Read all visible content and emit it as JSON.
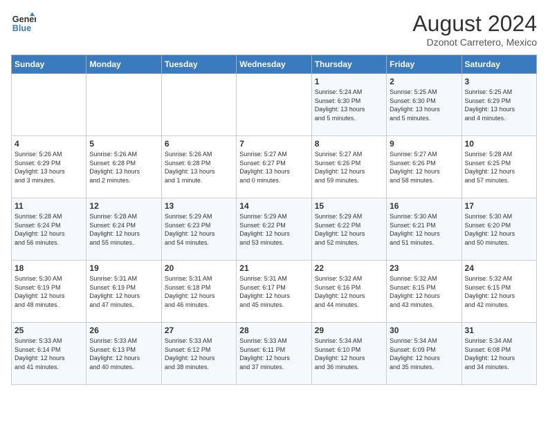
{
  "header": {
    "logo_line1": "General",
    "logo_line2": "Blue",
    "month_year": "August 2024",
    "location": "Dzonot Carretero, Mexico"
  },
  "days_of_week": [
    "Sunday",
    "Monday",
    "Tuesday",
    "Wednesday",
    "Thursday",
    "Friday",
    "Saturday"
  ],
  "weeks": [
    [
      {
        "day": "",
        "info": ""
      },
      {
        "day": "",
        "info": ""
      },
      {
        "day": "",
        "info": ""
      },
      {
        "day": "",
        "info": ""
      },
      {
        "day": "1",
        "info": "Sunrise: 5:24 AM\nSunset: 6:30 PM\nDaylight: 13 hours\nand 5 minutes."
      },
      {
        "day": "2",
        "info": "Sunrise: 5:25 AM\nSunset: 6:30 PM\nDaylight: 13 hours\nand 5 minutes."
      },
      {
        "day": "3",
        "info": "Sunrise: 5:25 AM\nSunset: 6:29 PM\nDaylight: 13 hours\nand 4 minutes."
      }
    ],
    [
      {
        "day": "4",
        "info": "Sunrise: 5:26 AM\nSunset: 6:29 PM\nDaylight: 13 hours\nand 3 minutes."
      },
      {
        "day": "5",
        "info": "Sunrise: 5:26 AM\nSunset: 6:28 PM\nDaylight: 13 hours\nand 2 minutes."
      },
      {
        "day": "6",
        "info": "Sunrise: 5:26 AM\nSunset: 6:28 PM\nDaylight: 13 hours\nand 1 minute."
      },
      {
        "day": "7",
        "info": "Sunrise: 5:27 AM\nSunset: 6:27 PM\nDaylight: 13 hours\nand 0 minutes."
      },
      {
        "day": "8",
        "info": "Sunrise: 5:27 AM\nSunset: 6:26 PM\nDaylight: 12 hours\nand 59 minutes."
      },
      {
        "day": "9",
        "info": "Sunrise: 5:27 AM\nSunset: 6:26 PM\nDaylight: 12 hours\nand 58 minutes."
      },
      {
        "day": "10",
        "info": "Sunrise: 5:28 AM\nSunset: 6:25 PM\nDaylight: 12 hours\nand 57 minutes."
      }
    ],
    [
      {
        "day": "11",
        "info": "Sunrise: 5:28 AM\nSunset: 6:24 PM\nDaylight: 12 hours\nand 56 minutes."
      },
      {
        "day": "12",
        "info": "Sunrise: 5:28 AM\nSunset: 6:24 PM\nDaylight: 12 hours\nand 55 minutes."
      },
      {
        "day": "13",
        "info": "Sunrise: 5:29 AM\nSunset: 6:23 PM\nDaylight: 12 hours\nand 54 minutes."
      },
      {
        "day": "14",
        "info": "Sunrise: 5:29 AM\nSunset: 6:22 PM\nDaylight: 12 hours\nand 53 minutes."
      },
      {
        "day": "15",
        "info": "Sunrise: 5:29 AM\nSunset: 6:22 PM\nDaylight: 12 hours\nand 52 minutes."
      },
      {
        "day": "16",
        "info": "Sunrise: 5:30 AM\nSunset: 6:21 PM\nDaylight: 12 hours\nand 51 minutes."
      },
      {
        "day": "17",
        "info": "Sunrise: 5:30 AM\nSunset: 6:20 PM\nDaylight: 12 hours\nand 50 minutes."
      }
    ],
    [
      {
        "day": "18",
        "info": "Sunrise: 5:30 AM\nSunset: 6:19 PM\nDaylight: 12 hours\nand 48 minutes."
      },
      {
        "day": "19",
        "info": "Sunrise: 5:31 AM\nSunset: 6:19 PM\nDaylight: 12 hours\nand 47 minutes."
      },
      {
        "day": "20",
        "info": "Sunrise: 5:31 AM\nSunset: 6:18 PM\nDaylight: 12 hours\nand 46 minutes."
      },
      {
        "day": "21",
        "info": "Sunrise: 5:31 AM\nSunset: 6:17 PM\nDaylight: 12 hours\nand 45 minutes."
      },
      {
        "day": "22",
        "info": "Sunrise: 5:32 AM\nSunset: 6:16 PM\nDaylight: 12 hours\nand 44 minutes."
      },
      {
        "day": "23",
        "info": "Sunrise: 5:32 AM\nSunset: 6:15 PM\nDaylight: 12 hours\nand 43 minutes."
      },
      {
        "day": "24",
        "info": "Sunrise: 5:32 AM\nSunset: 6:15 PM\nDaylight: 12 hours\nand 42 minutes."
      }
    ],
    [
      {
        "day": "25",
        "info": "Sunrise: 5:33 AM\nSunset: 6:14 PM\nDaylight: 12 hours\nand 41 minutes."
      },
      {
        "day": "26",
        "info": "Sunrise: 5:33 AM\nSunset: 6:13 PM\nDaylight: 12 hours\nand 40 minutes."
      },
      {
        "day": "27",
        "info": "Sunrise: 5:33 AM\nSunset: 6:12 PM\nDaylight: 12 hours\nand 38 minutes."
      },
      {
        "day": "28",
        "info": "Sunrise: 5:33 AM\nSunset: 6:11 PM\nDaylight: 12 hours\nand 37 minutes."
      },
      {
        "day": "29",
        "info": "Sunrise: 5:34 AM\nSunset: 6:10 PM\nDaylight: 12 hours\nand 36 minutes."
      },
      {
        "day": "30",
        "info": "Sunrise: 5:34 AM\nSunset: 6:09 PM\nDaylight: 12 hours\nand 35 minutes."
      },
      {
        "day": "31",
        "info": "Sunrise: 5:34 AM\nSunset: 6:08 PM\nDaylight: 12 hours\nand 34 minutes."
      }
    ]
  ]
}
